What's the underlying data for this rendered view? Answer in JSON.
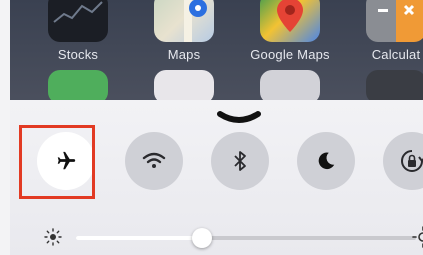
{
  "home_screen": {
    "apps": [
      {
        "label": "Stocks",
        "icon": "stocks-icon"
      },
      {
        "label": "Maps",
        "icon": "maps-icon"
      },
      {
        "label": "Google Maps",
        "icon": "google-maps-icon"
      },
      {
        "label": "Calculat",
        "icon": "calculator-icon"
      }
    ]
  },
  "control_center": {
    "toggles": [
      {
        "name": "airplane-mode",
        "icon": "airplane-icon",
        "active": true
      },
      {
        "name": "wifi",
        "icon": "wifi-icon",
        "active": false
      },
      {
        "name": "bluetooth",
        "icon": "bluetooth-icon",
        "active": false
      },
      {
        "name": "do-not-disturb",
        "icon": "moon-icon",
        "active": false
      },
      {
        "name": "rotation-lock",
        "icon": "rotation-lock-icon",
        "active": false
      }
    ],
    "brightness": {
      "level": 0.37
    }
  },
  "colors": {
    "highlight": "#e23a23",
    "active_toggle": "#ffffff",
    "inactive_toggle": "#cfd0d6"
  }
}
